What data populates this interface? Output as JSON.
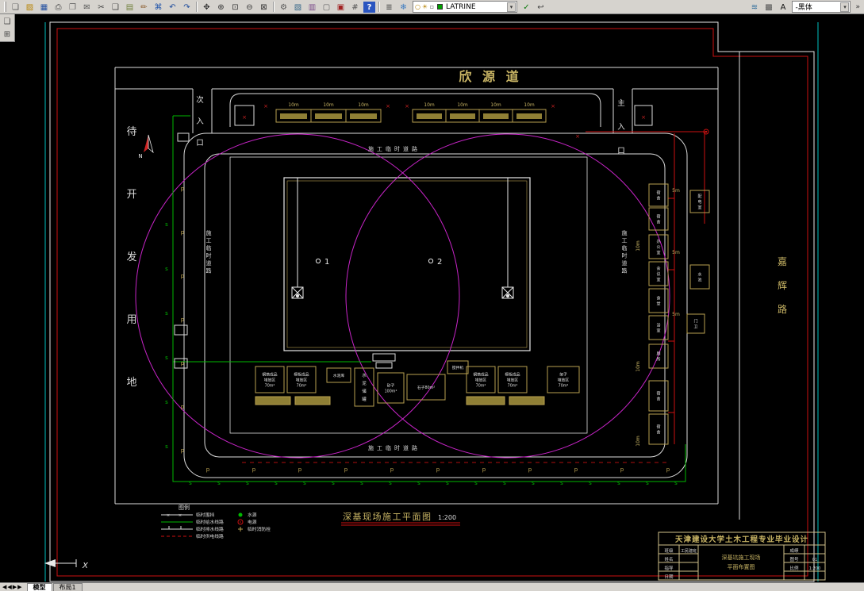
{
  "toolbar": {
    "groups": {
      "file": [
        {
          "n": "new-icon",
          "g": "❏",
          "c": "#555555"
        },
        {
          "n": "open-icon",
          "g": "▨",
          "c": "#b8860b"
        },
        {
          "n": "save-icon",
          "g": "▦",
          "c": "#234fa0"
        },
        {
          "n": "plot-icon",
          "g": "⎙",
          "c": "#444444"
        },
        {
          "n": "plot-preview-icon",
          "g": "❐",
          "c": "#666666"
        },
        {
          "n": "etransmit-icon",
          "g": "✉",
          "c": "#555555"
        },
        {
          "n": "cut-icon",
          "g": "✂",
          "c": "#444444"
        },
        {
          "n": "copy-icon",
          "g": "❑",
          "c": "#444444"
        },
        {
          "n": "paste-icon",
          "g": "▤",
          "c": "#6f7f3a"
        },
        {
          "n": "match-properties-icon",
          "g": "✏",
          "c": "#8a5a2a"
        },
        {
          "n": "hyperlink-icon",
          "g": "⌘",
          "c": "#2255aa"
        },
        {
          "n": "undo-icon",
          "g": "↶",
          "c": "#1f4c9c"
        },
        {
          "n": "redo-icon",
          "g": "↷",
          "c": "#1f4c9c"
        }
      ],
      "zoom": [
        {
          "n": "pan-icon",
          "g": "✥",
          "c": "#333333"
        },
        {
          "n": "zoom-realtime-icon",
          "g": "⊕",
          "c": "#333333"
        },
        {
          "n": "zoom-window-icon",
          "g": "⊡",
          "c": "#333333"
        },
        {
          "n": "zoom-previous-icon",
          "g": "⊖",
          "c": "#333333"
        },
        {
          "n": "zoom-extents-icon",
          "g": "⊠",
          "c": "#333333"
        }
      ],
      "tools": [
        {
          "n": "properties-icon",
          "g": "⚙",
          "c": "#555555"
        },
        {
          "n": "designcenter-icon",
          "g": "▧",
          "c": "#3a6a8a"
        },
        {
          "n": "tool-palettes-icon",
          "g": "▥",
          "c": "#7a4a8a"
        },
        {
          "n": "sheet-set-icon",
          "g": "▢",
          "c": "#666666"
        },
        {
          "n": "markup-icon",
          "g": "▣",
          "c": "#a02020"
        },
        {
          "n": "calculator-icon",
          "g": "#",
          "c": "#555555"
        },
        {
          "n": "help-icon",
          "g": "?",
          "c": "#ffffff",
          "bg": "#2a55c0"
        }
      ],
      "layers": [
        {
          "n": "layer-properties-icon",
          "g": "≣",
          "c": "#444444"
        },
        {
          "n": "layer-states-icon",
          "g": "❄",
          "c": "#3a7ac0"
        }
      ],
      "layertools": [
        {
          "n": "make-layer-current-icon",
          "g": "✓",
          "c": "#0a7a0a"
        },
        {
          "n": "layer-previous-icon",
          "g": "↩",
          "c": "#444444"
        }
      ],
      "styles": [
        {
          "n": "layer-walk-icon",
          "g": "≋",
          "c": "#2a6a9a"
        },
        {
          "n": "layer-match-icon",
          "g": "▩",
          "c": "#555555"
        },
        {
          "n": "text-style-icon",
          "g": "A",
          "c": "#111111"
        }
      ]
    },
    "layer_combo": {
      "bulb": "○",
      "sun": "☀",
      "lock": "▫",
      "value": "LATRINE",
      "swatch": "#00a000"
    },
    "font_combo": {
      "value": "-黑体"
    },
    "combo_arrow": "▾",
    "overflow": "»"
  },
  "side_toolbar": [
    {
      "n": "draw-toolbar-icon",
      "g": "❏",
      "c": "#444444"
    },
    {
      "n": "modify-toolbar-icon",
      "g": "⊞",
      "c": "#444444"
    }
  ],
  "tabs": {
    "nav": "◀◀▶▶",
    "model": "模型",
    "layout1": "布局1"
  },
  "site": {
    "street_top": "欣 源 道",
    "street_right": "嘉辉路",
    "vacant_left": "待开发用地",
    "entrance_main": "主入口",
    "entrance_secondary": "次入口",
    "road_label": "施工临时道路",
    "caption": "深基现场施工平面图",
    "caption_scale": "1:200",
    "crane1": "1",
    "crane2": "2",
    "north": "N",
    "dim_10m": "10m",
    "dim_5m": "5m",
    "fence_p": "p",
    "water_s": "s",
    "cross": "×",
    "storage": [
      {
        "lines": [
          "钢筋成品",
          "堆放区",
          "70m²"
        ]
      },
      {
        "lines": [
          "模板成品",
          "堆放区",
          "70m²"
        ]
      },
      {
        "lines": [
          "水泥库"
        ]
      },
      {
        "lines": [
          "水",
          "泥",
          "储",
          "罐"
        ]
      },
      {
        "lines": [
          "砂子",
          "100m²"
        ]
      },
      {
        "lines": [
          "石子80m²"
        ]
      },
      {
        "lines": [
          "搅拌机"
        ]
      },
      {
        "lines": [
          "钢筋成品",
          "堆放区",
          "70m²"
        ]
      },
      {
        "lines": [
          "模板成品",
          "堆放区",
          "70m²"
        ]
      },
      {
        "lines": [
          "架子",
          "堆放区",
          "70m²"
        ]
      }
    ],
    "rooms": [
      "宿舍",
      "宿舍",
      "办公室",
      "会议室",
      "食堂",
      "浴室",
      "厕所",
      "宿舍",
      "宿舍",
      "配电室",
      "水池",
      "门卫"
    ]
  },
  "legend": {
    "title": "图例",
    "left": [
      "临时围挡",
      "临时给水线路",
      "临时排水线路",
      "临时供电线路"
    ],
    "right": [
      "水源",
      "电源",
      "临时消防栓"
    ]
  },
  "titleblock": {
    "header": "天津建设大学土木工程专业毕业设计",
    "rows": [
      {
        "label": "班级",
        "value": "工民建班"
      },
      {
        "label": "姓名",
        "value": ""
      },
      {
        "label": "指导",
        "value": ""
      },
      {
        "label": "日期",
        "value": ""
      }
    ],
    "right_rows": [
      {
        "label": "成绩",
        "value": ""
      },
      {
        "label": "图号",
        "value": "01"
      },
      {
        "label": "比例",
        "value": "1:200"
      }
    ],
    "drawing_title_1": "深基坑施工现场",
    "drawing_title_2": "平面布置图"
  },
  "ucs": {
    "x_label": "X"
  }
}
